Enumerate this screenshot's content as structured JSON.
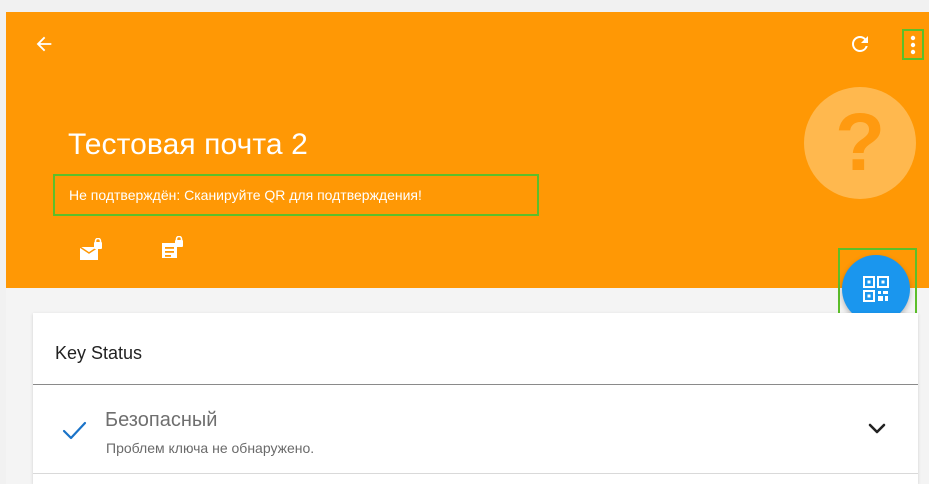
{
  "header": {
    "title": "Тестовая почта 2",
    "verification_warning": "Не подтверждён: Сканируйте QR для подтверждения!",
    "status_symbol": "?",
    "background_color": "#ff9805",
    "actions": {
      "back": "arrow-left-icon",
      "refresh": "refresh-icon",
      "overflow": "more-vert-icon"
    },
    "capabilities": [
      "can-encrypt-icon",
      "can-sign-icon"
    ]
  },
  "fab": {
    "icon": "qr-code-icon",
    "color": "#1a96ee"
  },
  "key_status_card": {
    "title": "Key Status",
    "status_label": "Безопасный",
    "status_description": "Проблем ключа не обнаружено.",
    "status_icon": "check-icon",
    "expand_icon": "chevron-down-icon"
  }
}
